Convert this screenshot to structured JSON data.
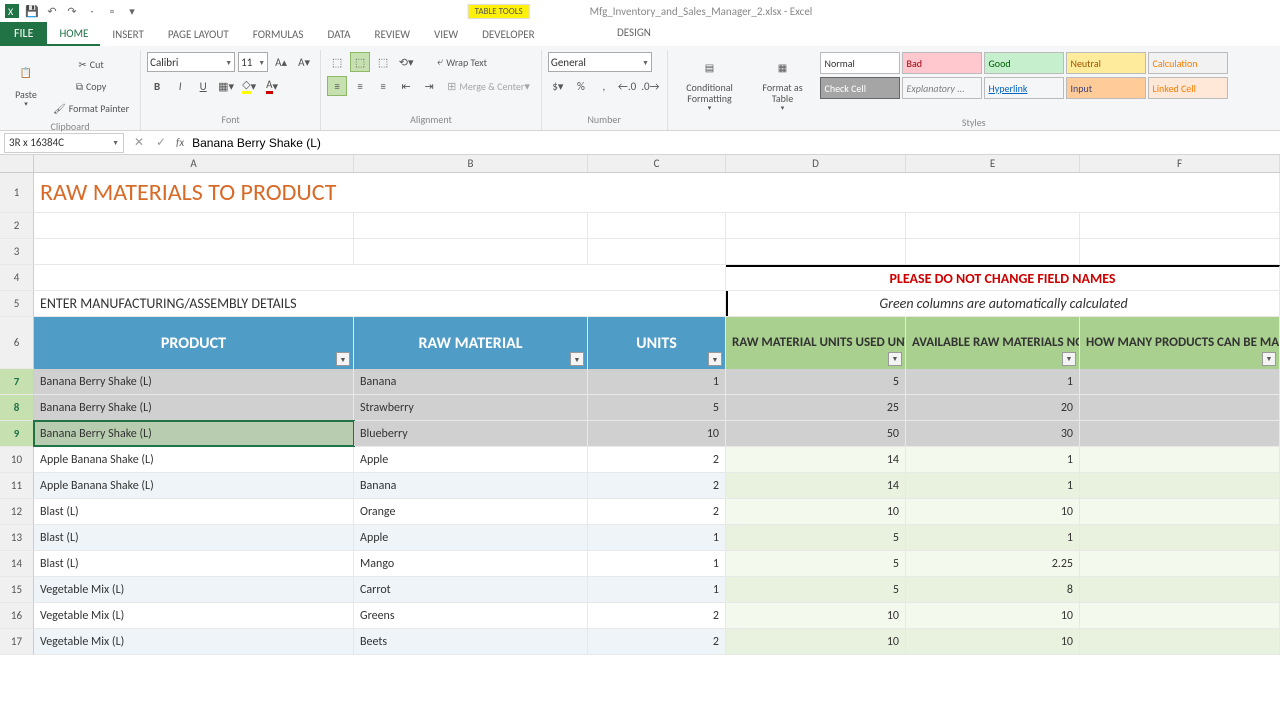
{
  "title_bar": {
    "table_tools": "TABLE TOOLS",
    "doc_title": "Mfg_Inventory_and_Sales_Manager_2.xlsx - Excel"
  },
  "tabs": {
    "file": "FILE",
    "list": [
      "HOME",
      "INSERT",
      "PAGE LAYOUT",
      "FORMULAS",
      "DATA",
      "REVIEW",
      "VIEW",
      "DEVELOPER"
    ],
    "design": "DESIGN",
    "active": "HOME"
  },
  "ribbon": {
    "clipboard": {
      "label": "Clipboard",
      "paste": "Paste",
      "cut": "Cut",
      "copy": "Copy",
      "fp": "Format Painter"
    },
    "font": {
      "label": "Font",
      "name": "Calibri",
      "size": "11"
    },
    "alignment": {
      "label": "Alignment",
      "wrap": "Wrap Text",
      "merge": "Merge & Center"
    },
    "number": {
      "label": "Number",
      "format": "General"
    },
    "styles": {
      "label": "Styles",
      "cond": "Conditional Formatting",
      "fat": "Format as Table",
      "items": [
        "Normal",
        "Bad",
        "Good",
        "Neutral",
        "Calculation",
        "Check Cell",
        "Explanatory ...",
        "Hyperlink",
        "Input",
        "Linked Cell"
      ]
    }
  },
  "formula_bar": {
    "name_box": "3R x 16384C",
    "formula": "Banana Berry Shake (L)"
  },
  "cols": {
    "letters": [
      "A",
      "B",
      "C",
      "D",
      "E",
      "F"
    ],
    "widths": [
      320,
      234,
      138,
      180,
      174,
      200
    ]
  },
  "sheet": {
    "title": "RAW MATERIALS TO PRODUCT",
    "warning": "PLEASE DO NOT CHANGE FIELD NAMES",
    "auto_note": "Green columns are automatically calculated",
    "enter_label": "ENTER MANUFACTURING/ASSEMBLY DETAILS",
    "headers": {
      "product": "PRODUCT",
      "raw_material": "RAW MATERIAL",
      "units": "UNITS",
      "used": "RAW MATERIAL UNITS USED UNTIL NOW",
      "available": "AVAILABLE RAW MATERIALS NOW",
      "can_make": "HOW MANY PRODUCTS CAN BE MADE?"
    },
    "rows": [
      {
        "n": 7,
        "product": "Banana Berry Shake (L)",
        "rm": "Banana",
        "units": 1,
        "used": 5,
        "avail": 1,
        "make": ""
      },
      {
        "n": 8,
        "product": "Banana Berry Shake (L)",
        "rm": "Strawberry",
        "units": 5,
        "used": 25,
        "avail": 20,
        "make": ""
      },
      {
        "n": 9,
        "product": "Banana Berry Shake (L)",
        "rm": "Blueberry",
        "units": 10,
        "used": 50,
        "avail": 30,
        "make": ""
      },
      {
        "n": 10,
        "product": "Apple Banana Shake (L)",
        "rm": "Apple",
        "units": 2,
        "used": 14,
        "avail": 1,
        "make": ""
      },
      {
        "n": 11,
        "product": "Apple Banana Shake (L)",
        "rm": "Banana",
        "units": 2,
        "used": 14,
        "avail": 1,
        "make": ""
      },
      {
        "n": 12,
        "product": "Blast (L)",
        "rm": "Orange",
        "units": 2,
        "used": 10,
        "avail": 10,
        "make": ""
      },
      {
        "n": 13,
        "product": "Blast (L)",
        "rm": "Apple",
        "units": 1,
        "used": 5,
        "avail": 1,
        "make": ""
      },
      {
        "n": 14,
        "product": "Blast (L)",
        "rm": "Mango",
        "units": 1,
        "used": 5,
        "avail": 2.25,
        "make": ""
      },
      {
        "n": 15,
        "product": "Vegetable Mix (L)",
        "rm": "Carrot",
        "units": 1,
        "used": 5,
        "avail": 8,
        "make": ""
      },
      {
        "n": 16,
        "product": "Vegetable Mix (L)",
        "rm": "Greens",
        "units": 2,
        "used": 10,
        "avail": 10,
        "make": ""
      },
      {
        "n": 17,
        "product": "Vegetable Mix (L)",
        "rm": "Beets",
        "units": 2,
        "used": 10,
        "avail": 10,
        "make": ""
      }
    ],
    "selected_rows": [
      7,
      8,
      9
    ]
  }
}
